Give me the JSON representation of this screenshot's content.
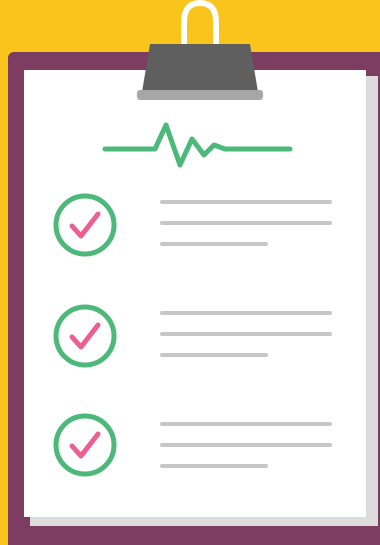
{
  "colors": {
    "background": "#f9c41b",
    "board": "#7d3d63",
    "paper": "#ffffff",
    "paper_shadow": "#dcdcdc",
    "clip_dark": "#5f5f5f",
    "clip_rim": "#a7a7a7",
    "pulse": "#4cb97a",
    "check_circle": "#4cb97a",
    "check_mark": "#ec5f8f",
    "text_line": "#c7c7c7"
  },
  "icons": {
    "clip": "binder-clip-icon",
    "pulse": "heartbeat-icon",
    "check": "check-circle-icon"
  },
  "checklist": {
    "item_count": 3,
    "lines_per_item": 3
  }
}
